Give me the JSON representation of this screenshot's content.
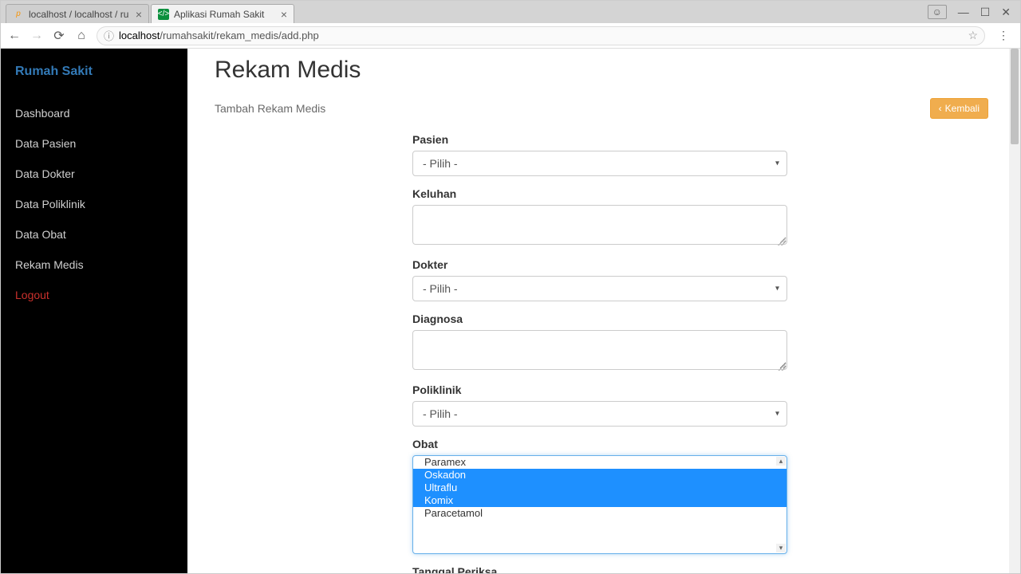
{
  "browser": {
    "tabs": [
      {
        "title": "localhost / localhost / ru",
        "favicon": "pMA",
        "active": false
      },
      {
        "title": "Aplikasi Rumah Sakit",
        "favicon": "</>",
        "active": true
      }
    ],
    "url_host": "localhost",
    "url_path": "/rumahsakit/rekam_medis/add.php"
  },
  "sidebar": {
    "brand": "Rumah Sakit",
    "items": [
      "Dashboard",
      "Data Pasien",
      "Data Dokter",
      "Data Poliklinik",
      "Data Obat",
      "Rekam Medis"
    ],
    "logout": "Logout"
  },
  "header": {
    "title": "Rekam Medis",
    "subtitle": "Tambah Rekam Medis",
    "back_label": "Kembali"
  },
  "form": {
    "pasien": {
      "label": "Pasien",
      "value": "- Pilih -"
    },
    "keluhan": {
      "label": "Keluhan",
      "value": ""
    },
    "dokter": {
      "label": "Dokter",
      "value": "- Pilih -"
    },
    "diagnosa": {
      "label": "Diagnosa",
      "value": ""
    },
    "poliklinik": {
      "label": "Poliklinik",
      "value": "- Pilih -"
    },
    "obat": {
      "label": "Obat",
      "options": [
        {
          "label": "Paramex",
          "selected": false
        },
        {
          "label": "Oskadon",
          "selected": true
        },
        {
          "label": "Ultraflu",
          "selected": true
        },
        {
          "label": "Komix",
          "selected": true
        },
        {
          "label": "Paracetamol",
          "selected": false
        }
      ]
    },
    "tanggal": {
      "label": "Tanggal Periksa"
    }
  }
}
